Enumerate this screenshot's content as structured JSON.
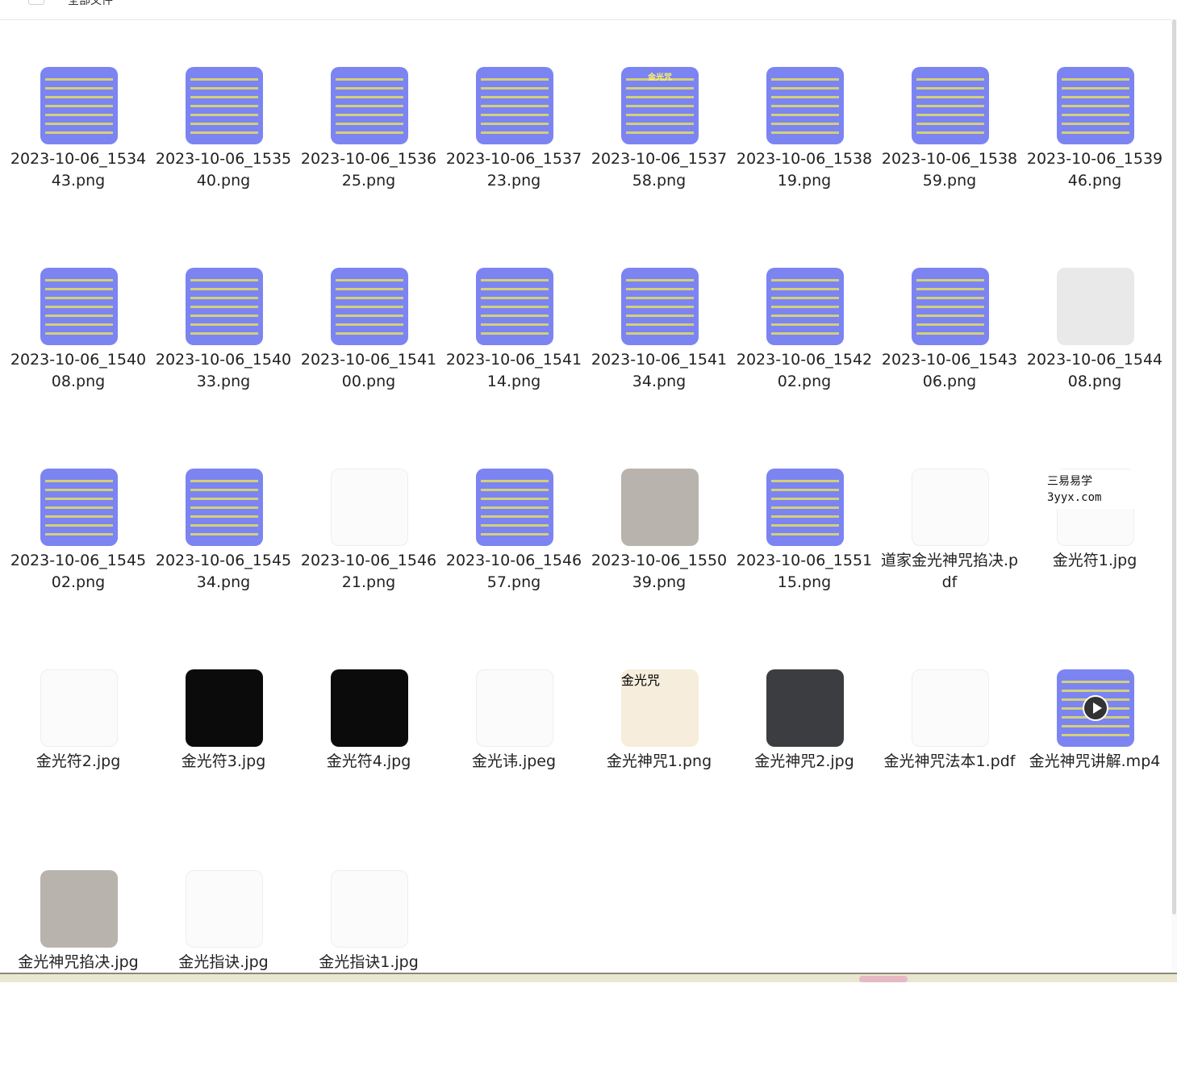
{
  "header": {
    "label": "全部文件"
  },
  "watermark": {
    "line1": "三易易学",
    "line2": "3yyx.com"
  },
  "files": [
    {
      "name": "2023-10-06_153443.png",
      "thumb": "slide"
    },
    {
      "name": "2023-10-06_153540.png",
      "thumb": "slide"
    },
    {
      "name": "2023-10-06_153625.png",
      "thumb": "slide"
    },
    {
      "name": "2023-10-06_153723.png",
      "thumb": "slide"
    },
    {
      "name": "2023-10-06_153758.png",
      "thumb": "slide",
      "slide_title": "金光咒"
    },
    {
      "name": "2023-10-06_153819.png",
      "thumb": "slide"
    },
    {
      "name": "2023-10-06_153859.png",
      "thumb": "slide"
    },
    {
      "name": "2023-10-06_153946.png",
      "thumb": "slide"
    },
    {
      "name": "2023-10-06_154008.png",
      "thumb": "slide"
    },
    {
      "name": "2023-10-06_154033.png",
      "thumb": "slide"
    },
    {
      "name": "2023-10-06_154100.png",
      "thumb": "slide"
    },
    {
      "name": "2023-10-06_154114.png",
      "thumb": "slide"
    },
    {
      "name": "2023-10-06_154134.png",
      "thumb": "slide"
    },
    {
      "name": "2023-10-06_154202.png",
      "thumb": "slide"
    },
    {
      "name": "2023-10-06_154306.png",
      "thumb": "slide"
    },
    {
      "name": "2023-10-06_154408.png",
      "thumb": "sketch"
    },
    {
      "name": "2023-10-06_154502.png",
      "thumb": "slide"
    },
    {
      "name": "2023-10-06_154534.png",
      "thumb": "slide"
    },
    {
      "name": "2023-10-06_154621.png",
      "thumb": "white"
    },
    {
      "name": "2023-10-06_154657.png",
      "thumb": "slide"
    },
    {
      "name": "2023-10-06_155039.png",
      "thumb": "photo"
    },
    {
      "name": "2023-10-06_155115.png",
      "thumb": "slide"
    },
    {
      "name": "道家金光神咒掐决.pdf",
      "thumb": "white"
    },
    {
      "name": "金光符1.jpg",
      "thumb": "white"
    },
    {
      "name": "金光符2.jpg",
      "thumb": "white"
    },
    {
      "name": "金光符3.jpg",
      "thumb": "dark"
    },
    {
      "name": "金光符4.jpg",
      "thumb": "dark"
    },
    {
      "name": "金光讳.jpeg",
      "thumb": "white"
    },
    {
      "name": "金光神咒1.png",
      "thumb": "cream",
      "slide_title": "金光咒"
    },
    {
      "name": "金光神咒2.jpg",
      "thumb": "book"
    },
    {
      "name": "金光神咒法本1.pdf",
      "thumb": "white"
    },
    {
      "name": "金光神咒讲解.mp4",
      "thumb": "video"
    },
    {
      "name": "金光神咒掐决.jpg",
      "thumb": "photo"
    },
    {
      "name": "金光指诀.jpg",
      "thumb": "white"
    },
    {
      "name": "金光指诀1.jpg",
      "thumb": "white"
    }
  ]
}
